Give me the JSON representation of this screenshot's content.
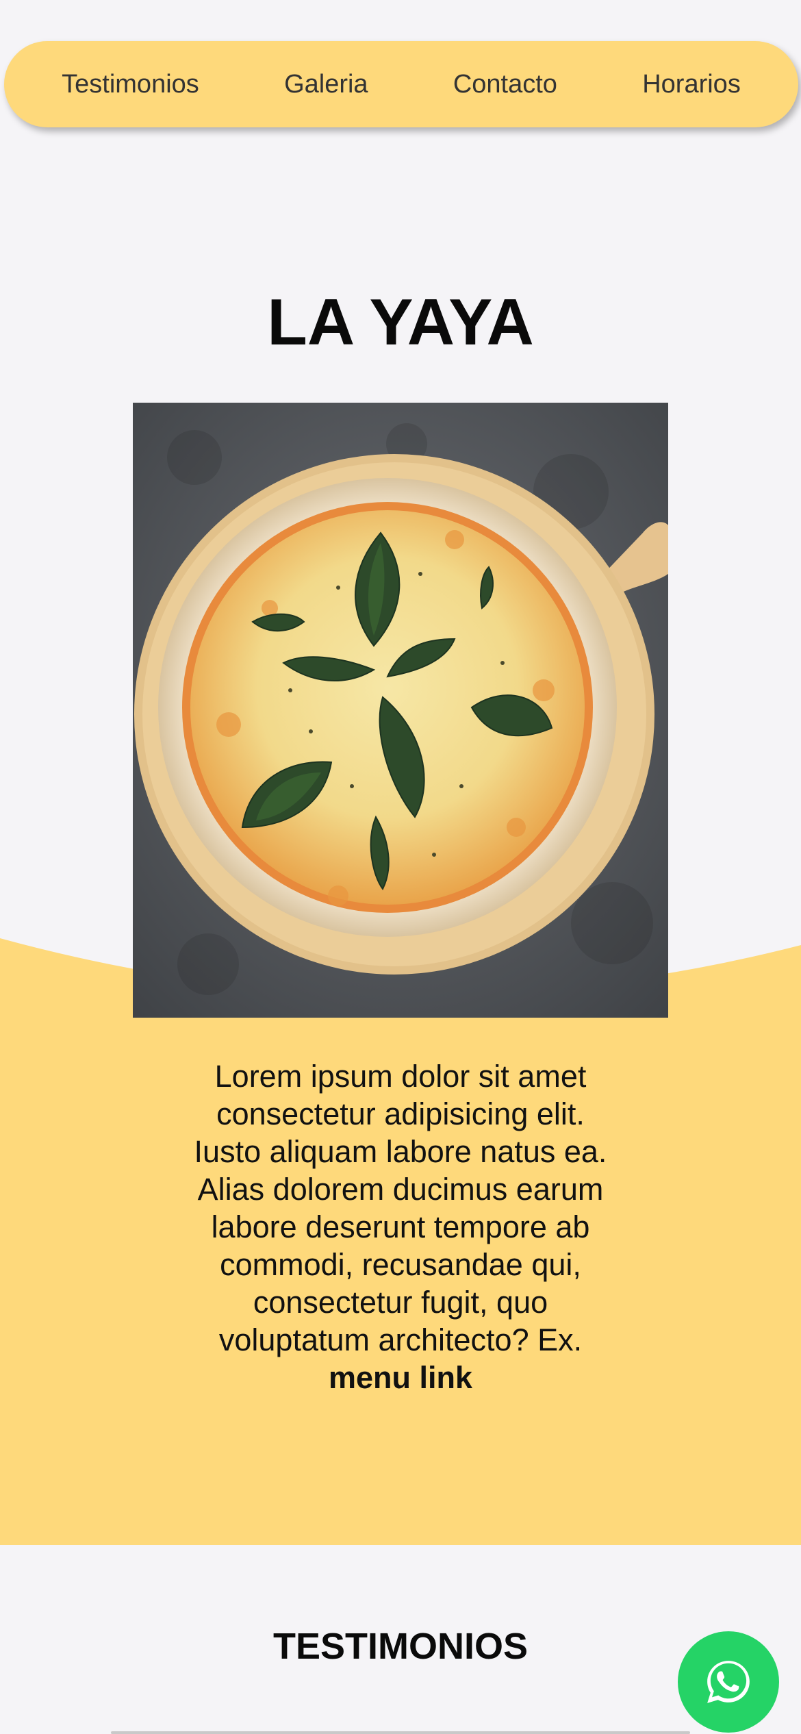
{
  "nav": {
    "items": [
      {
        "label": "Testimonios"
      },
      {
        "label": "Galeria"
      },
      {
        "label": "Contacto"
      },
      {
        "label": "Horarios"
      }
    ],
    "bg_color": "#fed97b"
  },
  "hero": {
    "title": "LA YAYA",
    "image_icon": "pizza-image",
    "text": "Lorem ipsum dolor sit amet consectetur adipisicing elit. Iusto aliquam labore natus ea. Alias dolorem ducimus earum labore deserunt tempore ab commodi, recusandae qui, consectetur fugit, quo voluptatum architecto? Ex.",
    "link_label": "menu link",
    "band_color": "#fed97b"
  },
  "testimonials": {
    "title": "TESTIMONIOS"
  },
  "whatsapp": {
    "icon": "whatsapp-icon",
    "color": "#25d366"
  }
}
